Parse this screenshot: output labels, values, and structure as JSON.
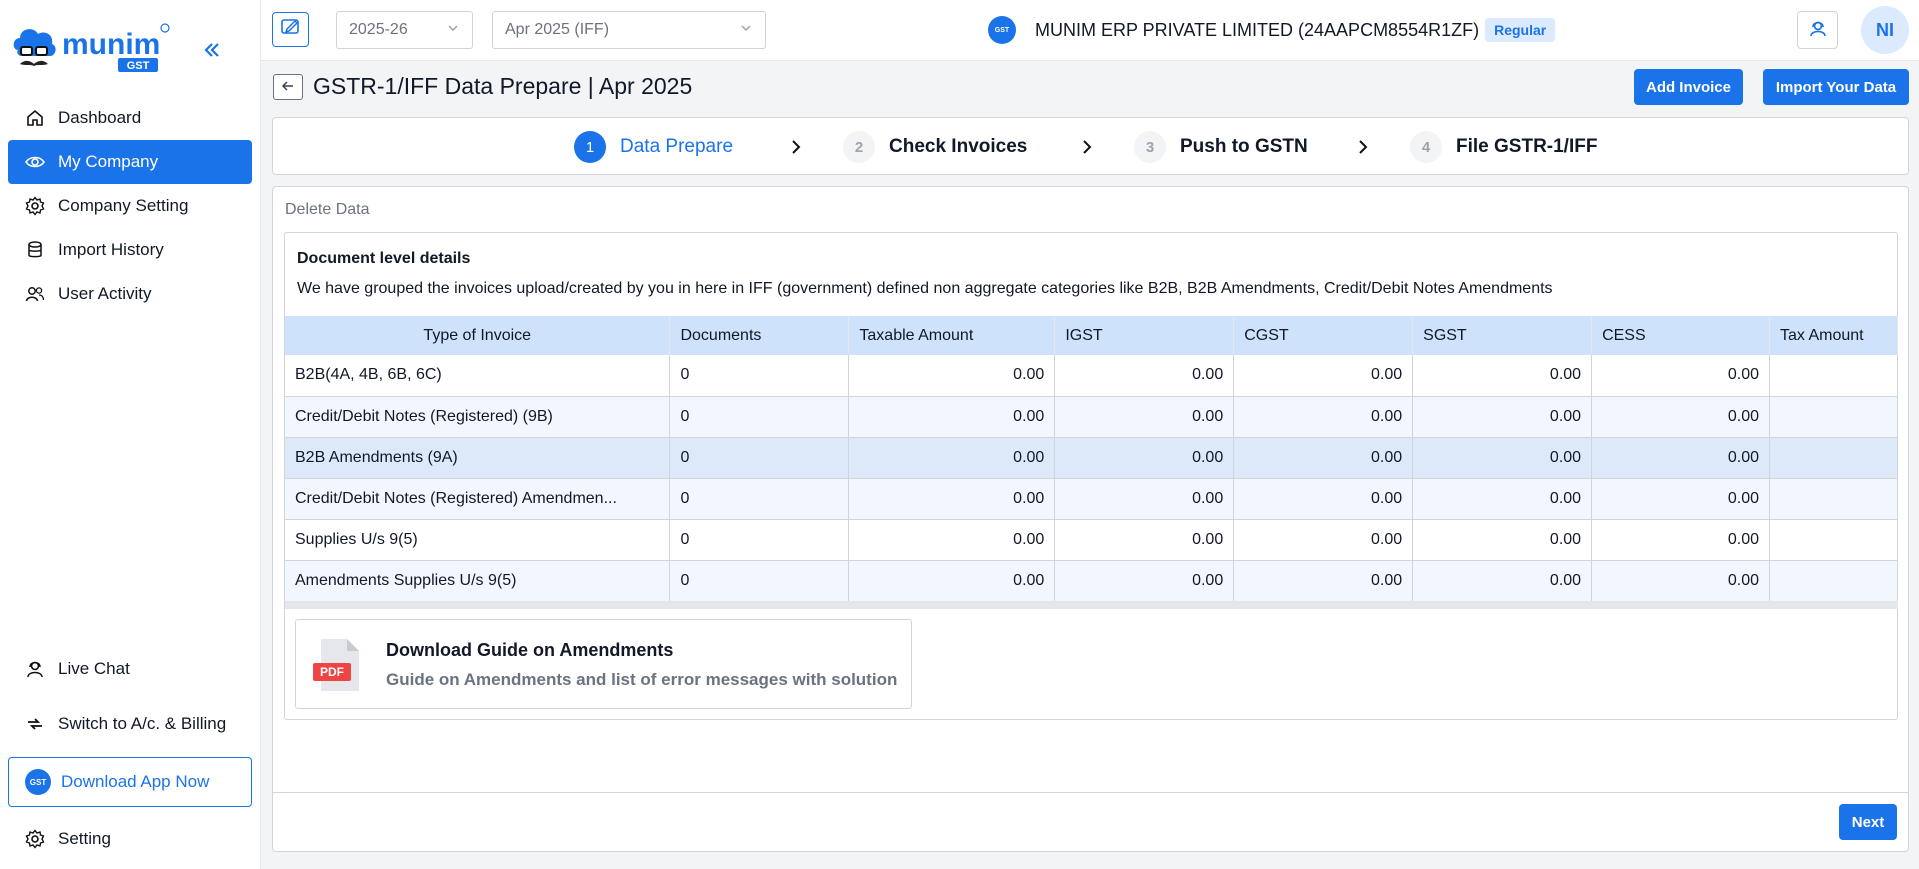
{
  "sidebar": {
    "logo_text": "munim",
    "logo_badge": "GST",
    "nav": [
      {
        "label": "Dashboard",
        "icon": "home-icon"
      },
      {
        "label": "My Company",
        "icon": "eye-icon"
      },
      {
        "label": "Company Setting",
        "icon": "gear-icon"
      },
      {
        "label": "Import History",
        "icon": "database-icon"
      },
      {
        "label": "User Activity",
        "icon": "users-icon"
      }
    ],
    "bottom": {
      "live_chat": "Live Chat",
      "switch": "Switch to A/c. & Billing",
      "download_app": "Download App Now",
      "setting": "Setting"
    }
  },
  "topbar": {
    "year": "2025-26",
    "month": "Apr 2025 (IFF)",
    "company_name": "MUNIM ERP PRIVATE LIMITED (24AAPCM8554R1ZF)",
    "company_type": "Regular",
    "avatar_initials": "NI"
  },
  "page": {
    "title": "GSTR-1/IFF Data Prepare | Apr 2025",
    "add_invoice": "Add Invoice",
    "import_data": "Import Your Data",
    "next": "Next"
  },
  "stepper": [
    {
      "num": "1",
      "label": "Data Prepare"
    },
    {
      "num": "2",
      "label": "Check Invoices"
    },
    {
      "num": "3",
      "label": "Push to GSTN"
    },
    {
      "num": "4",
      "label": "File GSTR-1/IFF"
    }
  ],
  "main": {
    "delete_data": "Delete Data",
    "doc_title": "Document level details",
    "doc_desc": "We have grouped the invoices upload/created by you in here in IFF (government) defined non aggregate categories like B2B, B2B Amendments, Credit/Debit Notes Amendments",
    "table": {
      "headers": [
        "Type of Invoice",
        "Documents",
        "Taxable Amount",
        "IGST",
        "CGST",
        "SGST",
        "CESS",
        "Tax Amount"
      ],
      "rows": [
        [
          "B2B(4A, 4B, 6B, 6C)",
          "0",
          "0.00",
          "0.00",
          "0.00",
          "0.00",
          "0.00",
          ""
        ],
        [
          "Credit/Debit Notes (Registered) (9B)",
          "0",
          "0.00",
          "0.00",
          "0.00",
          "0.00",
          "0.00",
          ""
        ],
        [
          "B2B Amendments (9A)",
          "0",
          "0.00",
          "0.00",
          "0.00",
          "0.00",
          "0.00",
          ""
        ],
        [
          "Credit/Debit Notes (Registered) Amendmen...",
          "0",
          "0.00",
          "0.00",
          "0.00",
          "0.00",
          "0.00",
          ""
        ],
        [
          "Supplies U/s 9(5)",
          "0",
          "0.00",
          "0.00",
          "0.00",
          "0.00",
          "0.00",
          ""
        ],
        [
          "Amendments Supplies U/s 9(5)",
          "0",
          "0.00",
          "0.00",
          "0.00",
          "0.00",
          "0.00",
          ""
        ]
      ]
    },
    "guide": {
      "icon_label": "PDF",
      "title": "Download Guide on Amendments",
      "subtitle": "Guide on Amendments and list of error messages with solution"
    }
  }
}
